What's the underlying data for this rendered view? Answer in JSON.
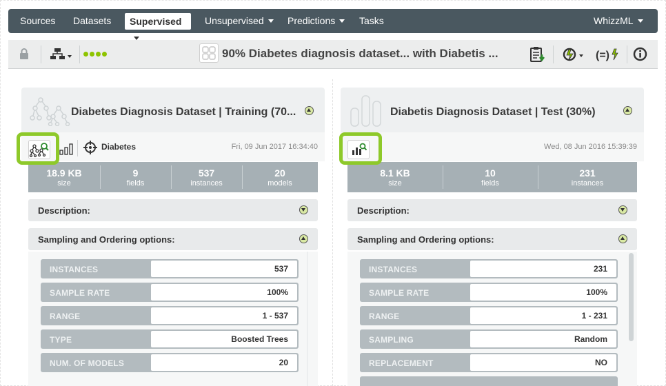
{
  "nav": {
    "items": [
      {
        "label": "Sources"
      },
      {
        "label": "Datasets"
      },
      {
        "label": "Supervised"
      },
      {
        "label": "Unsupervised"
      },
      {
        "label": "Predictions"
      },
      {
        "label": "Tasks"
      },
      {
        "label": "WhizzML"
      }
    ]
  },
  "toolbar": {
    "title": "90% Diabetes diagnosis dataset... with Diabetis ..."
  },
  "left": {
    "title": "Diabetes Diagnosis Dataset | Training (70...",
    "objective": "Diabetes",
    "date": "Fri, 09 Jun 2017 16:34:40",
    "stats": [
      {
        "value": "18.9 KB",
        "label": "size"
      },
      {
        "value": "9",
        "label": "fields"
      },
      {
        "value": "537",
        "label": "instances"
      },
      {
        "value": "20",
        "label": "models"
      }
    ],
    "description_label": "Description:",
    "sampling_label": "Sampling and Ordering options:",
    "options": [
      {
        "key": "INSTANCES",
        "value": "537"
      },
      {
        "key": "SAMPLE RATE",
        "value": "100%"
      },
      {
        "key": "RANGE",
        "value": "1 - 537"
      },
      {
        "key": "TYPE",
        "value": "Boosted Trees"
      },
      {
        "key": "NUM. OF MODELS",
        "value": "20"
      }
    ]
  },
  "right": {
    "title": "Diabetis Diagnosis Dataset | Test (30%)",
    "date": "Wed, 08 Jun 2016 15:39:39",
    "stats": [
      {
        "value": "8.1 KB",
        "label": "size"
      },
      {
        "value": "10",
        "label": "fields"
      },
      {
        "value": "231",
        "label": "instances"
      }
    ],
    "description_label": "Description:",
    "sampling_label": "Sampling and Ordering options:",
    "options": [
      {
        "key": "INSTANCES",
        "value": "231"
      },
      {
        "key": "SAMPLE RATE",
        "value": "100%"
      },
      {
        "key": "RANGE",
        "value": "1 - 231"
      },
      {
        "key": "SAMPLING",
        "value": "Random"
      },
      {
        "key": "REPLACEMENT",
        "value": "NO"
      }
    ]
  },
  "colors": {
    "nav_bg": "#4a5860",
    "accent_green": "#8ec92a",
    "stats_bg": "#a6b0b5"
  }
}
